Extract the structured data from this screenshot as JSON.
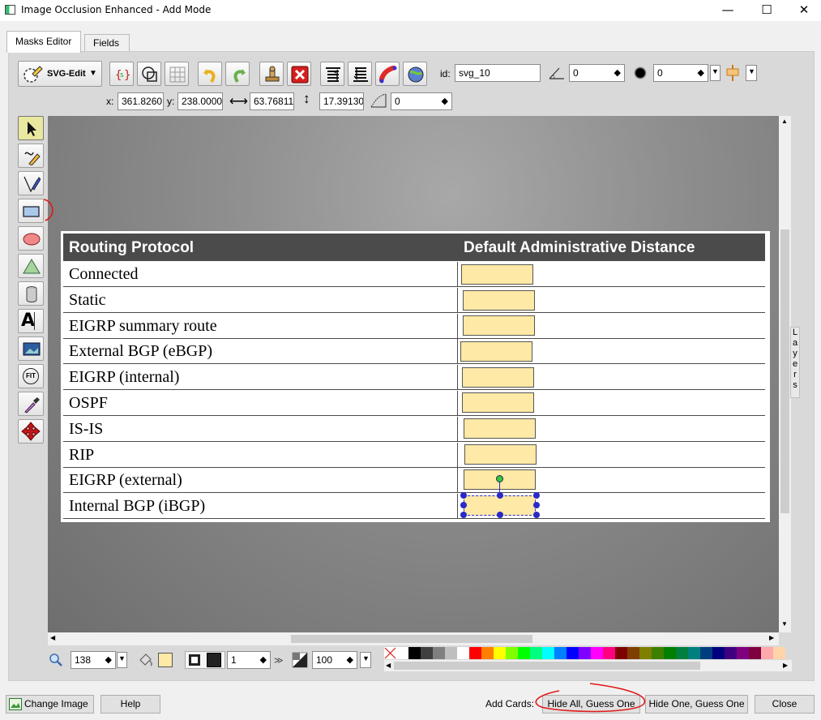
{
  "window": {
    "title": "Image Occlusion Enhanced - Add Mode",
    "minimize": "—",
    "maximize": "☐",
    "close": "✕"
  },
  "tabs": [
    {
      "label": "Masks Editor"
    },
    {
      "label": "Fields"
    }
  ],
  "toolbar": {
    "svgedit_label": "SVG-Edit",
    "id_label": "id:",
    "id_value": "svg_10",
    "angle_value": "0",
    "blur_value": "0",
    "x_label": "x:",
    "x_value": "361.8260",
    "y_label": "y:",
    "y_value": "238.0000",
    "w_value": "63.76811",
    "h_value": "17.39130",
    "radius_value": "0"
  },
  "left_tools": [
    "select-tool",
    "pencil-tool",
    "path-tool",
    "rectangle-tool",
    "ellipse-tool",
    "polygon-tool",
    "layer-tool",
    "text-tool",
    "image-tool",
    "fit-tool",
    "eyedropper-tool",
    "pan-tool"
  ],
  "fit_label": "FIT",
  "text_tool_label": "A",
  "layers_label": "Layers",
  "table": {
    "header_protocol": "Routing Protocol",
    "header_distance": "Default Administrative Distance",
    "rows": [
      "Connected",
      "Static",
      "EIGRP summary route",
      "External BGP (eBGP)",
      "EIGRP (internal)",
      "OSPF",
      "IS-IS",
      "RIP",
      "EIGRP (external)",
      "Internal BGP (iBGP)"
    ]
  },
  "bottom": {
    "zoom_value": "138",
    "stroke_width": "1",
    "opacity_value": "100",
    "mask_fill_color": "#ffe9a6"
  },
  "palette": [
    "#ffffff",
    "#000000",
    "#3f3f3f",
    "#7f7f7f",
    "#bfbfbf",
    "#ffffff",
    "#ff0000",
    "#ff7f00",
    "#ffff00",
    "#7fff00",
    "#00ff00",
    "#00ff7f",
    "#00ffff",
    "#007fff",
    "#0000ff",
    "#7f00ff",
    "#ff00ff",
    "#ff007f",
    "#7f0000",
    "#7f3f00",
    "#7f7f00",
    "#3f7f00",
    "#007f00",
    "#007f3f",
    "#007f7f",
    "#003f7f",
    "#00007f",
    "#3f007f",
    "#7f007f",
    "#7f003f",
    "#ffaaaa",
    "#ffd4aa"
  ],
  "footer": {
    "change_image": "Change Image",
    "help": "Help",
    "add_cards": "Add Cards:",
    "hide_all": "Hide All, Guess One",
    "hide_one": "Hide One, Guess One",
    "close": "Close"
  }
}
